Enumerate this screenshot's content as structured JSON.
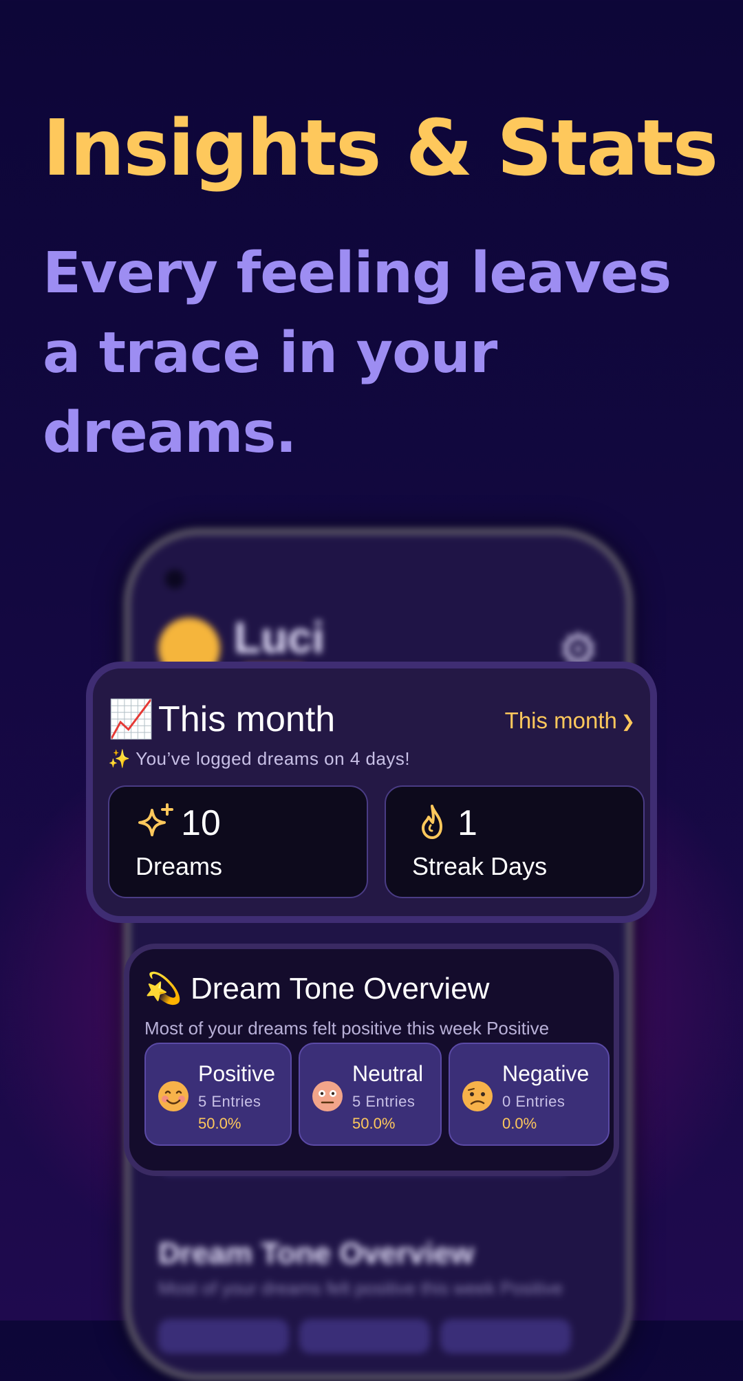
{
  "header": {
    "title": "Insights & Stats",
    "subtitle": "Every feeling leaves a trace in your dreams."
  },
  "phone": {
    "user_name": "Luci",
    "icon": "gear-icon",
    "section_title": "Dream Tone Overview",
    "section_subtitle": "Most of your dreams felt positive this week Positive"
  },
  "month_card": {
    "emoji": "📈",
    "title": "This month",
    "period_select": "This month",
    "subtitle": "✨ You’ve logged dreams on 4 days!",
    "stats": [
      {
        "icon": "sparkles-icon",
        "value": "10",
        "label": "Dreams"
      },
      {
        "icon": "flame-icon",
        "value": "1",
        "label": "Streak Days"
      }
    ]
  },
  "tone_card": {
    "emoji": "💫",
    "title": "Dream Tone Overview",
    "subtitle": "Most of your dreams felt positive this week Positive",
    "tones": [
      {
        "icon": "smiling-face-icon",
        "name": "Positive",
        "entries": "5 Entries",
        "percent": "50.0%",
        "share": 0.5
      },
      {
        "icon": "neutral-face-icon",
        "name": "Neutral",
        "entries": "5 Entries",
        "percent": "50.0%",
        "share": 0.5
      },
      {
        "icon": "confused-face-icon",
        "name": "Negative",
        "entries": "0 Entries",
        "percent": "0.0%",
        "share": 0.0
      }
    ]
  },
  "colors": {
    "accent_yellow": "#fec85c",
    "accent_purple": "#9d8df2"
  }
}
